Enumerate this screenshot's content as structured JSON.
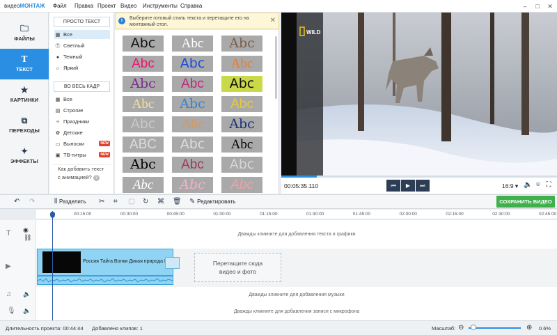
{
  "app": {
    "logo_plain": "видео",
    "logo_bold": "МОНТАЖ"
  },
  "menu": [
    "Файл",
    "Правка",
    "Проект",
    "Видео",
    "Инструменты",
    "Справка"
  ],
  "window_controls": {
    "minimize": "–",
    "maximize": "□",
    "close": "✕"
  },
  "nav": [
    {
      "label": "ФАЙЛЫ",
      "icon": "folder-icon"
    },
    {
      "label": "ТЕКСТ",
      "icon": "text-icon",
      "active": true
    },
    {
      "label": "КАРТИНКИ",
      "icon": "star-icon"
    },
    {
      "label": "ПЕРЕХОДЫ",
      "icon": "transitions-icon"
    },
    {
      "label": "ЭФФЕКТЫ",
      "icon": "magic-wand-icon"
    }
  ],
  "categories": {
    "group1_title": "ПРОСТО ТЕКСТ",
    "group1": [
      {
        "label": "Все",
        "icon": "grid-icon",
        "selected": true
      },
      {
        "label": "Светлый",
        "icon": "light-text-icon"
      },
      {
        "label": "Темный",
        "icon": "dark-text-icon"
      },
      {
        "label": "Яркий",
        "icon": "sun-icon"
      }
    ],
    "group2_title": "ВО ВЕСЬ КАДР",
    "group2": [
      {
        "label": "Все",
        "icon": "grid-icon"
      },
      {
        "label": "Строгие",
        "icon": "strict-icon"
      },
      {
        "label": "Праздники",
        "icon": "holiday-icon"
      },
      {
        "label": "Детские",
        "icon": "kids-icon"
      },
      {
        "label": "Выноски",
        "icon": "callout-icon",
        "badge": "NEW"
      },
      {
        "label": "ТВ-титры",
        "icon": "tv-icon",
        "badge": "NEW"
      }
    ],
    "howto_line1": "Как добавить текст",
    "howto_line2": "с анимацией?",
    "help_symbol": "?"
  },
  "info": {
    "text": "Выберите готовый стиль текста и перетащите его на монтажный стол.",
    "icon_symbol": "i",
    "close": "✕"
  },
  "styles": [
    {
      "text": "Abc",
      "fg": "#111111",
      "bg": "#a9a9a9"
    },
    {
      "text": "Abc",
      "fg": "#ffffff",
      "bg": "#a9a9a9"
    },
    {
      "text": "Abc",
      "fg": "#7a5c4a",
      "bg": "#a9a9a9"
    },
    {
      "text": "Abc",
      "fg": "#e8176e",
      "bg": "#a9a9a9"
    },
    {
      "text": "Abc",
      "fg": "#1a4fd6",
      "bg": "#a9a9a9"
    },
    {
      "text": "Abc",
      "fg": "#ef7b22",
      "bg": "#a9a9a9"
    },
    {
      "text": "Abc",
      "fg": "#7c2d8e",
      "bg": "#a9a9a9"
    },
    {
      "text": "Abc",
      "fg": "#c02a7b",
      "bg": "#a9a9a9"
    },
    {
      "text": "Abc",
      "fg": "#101010",
      "bg": "#c9d94a"
    },
    {
      "text": "Abc",
      "fg": "#f5e29a",
      "bg": "#a9a9a9"
    },
    {
      "text": "Abc",
      "fg": "#2f86d8",
      "bg": "#a9a9a9"
    },
    {
      "text": "Abc",
      "fg": "#e9c93a",
      "bg": "#a9a9a9"
    },
    {
      "text": "Abc",
      "fg": "#c9c9c9",
      "bg": "#a9a9a9"
    },
    {
      "text": "Abc",
      "fg": "#d29a60",
      "bg": "#a9a9a9"
    },
    {
      "text": "Abc",
      "fg": "#1a2f7a",
      "bg": "#a9a9a9"
    },
    {
      "text": "ABC",
      "fg": "#dcdcdc",
      "bg": "#a9a9a9"
    },
    {
      "text": "Abc",
      "fg": "#dddddd",
      "bg": "#a9a9a9"
    },
    {
      "text": "Abc",
      "fg": "#000000",
      "bg": "#a9a9a9"
    },
    {
      "text": "Abc",
      "fg": "#000000",
      "bg": "#a9a9a9"
    },
    {
      "text": "Abc",
      "fg": "#9a3a5c",
      "bg": "#a9a9a9"
    },
    {
      "text": "Abc",
      "fg": "#d6d6d6",
      "bg": "#a9a9a9"
    },
    {
      "text": "Abc",
      "fg": "#ffffff",
      "bg": "#a9a9a9"
    },
    {
      "text": "Abc",
      "fg": "#f2b2c2",
      "bg": "#a9a9a9"
    },
    {
      "text": "Abc",
      "fg": "#f0a0aa",
      "bg": "#a9a9a9"
    }
  ],
  "preview": {
    "timecode": "00:05:35.110",
    "progress": 0.13,
    "aspect": "16:9",
    "controls": {
      "prev": "⏮",
      "play": "▶",
      "next": "⏭"
    },
    "badge": "WILD"
  },
  "toolbar": {
    "undo": "↶",
    "redo": "↷",
    "split_label": "Разделить",
    "edit_label": "Редактировать",
    "export_label": "СОХРАНИТЬ ВИДЕО"
  },
  "ruler": [
    "00:15:00",
    "00:30:00",
    "00:45:00",
    "01:00:00",
    "01:15:00",
    "01:30:00",
    "01:45:00",
    "02:00:00",
    "02:15:00",
    "02:30:00",
    "02:45:00"
  ],
  "tracks": {
    "text_hint": "Дважды кликните для добавления текста и графики",
    "clip_title": "Россия Тайга Волки Дикая природа Н",
    "drop_line1": "Перетащите сюда",
    "drop_line2": "видео и фото",
    "music_hint": "Дважды кликните для добавления музыки",
    "mic_hint": "Дважды кликните для добавления записи с микрофона"
  },
  "status": {
    "duration": "Длительность проекта: 00:44:44",
    "clips": "Добавлено клипов: 1",
    "zoom_label": "Масштаб:",
    "zoom_minus": "⊖",
    "zoom_plus": "⊕",
    "zoom_value": "0.6%"
  }
}
